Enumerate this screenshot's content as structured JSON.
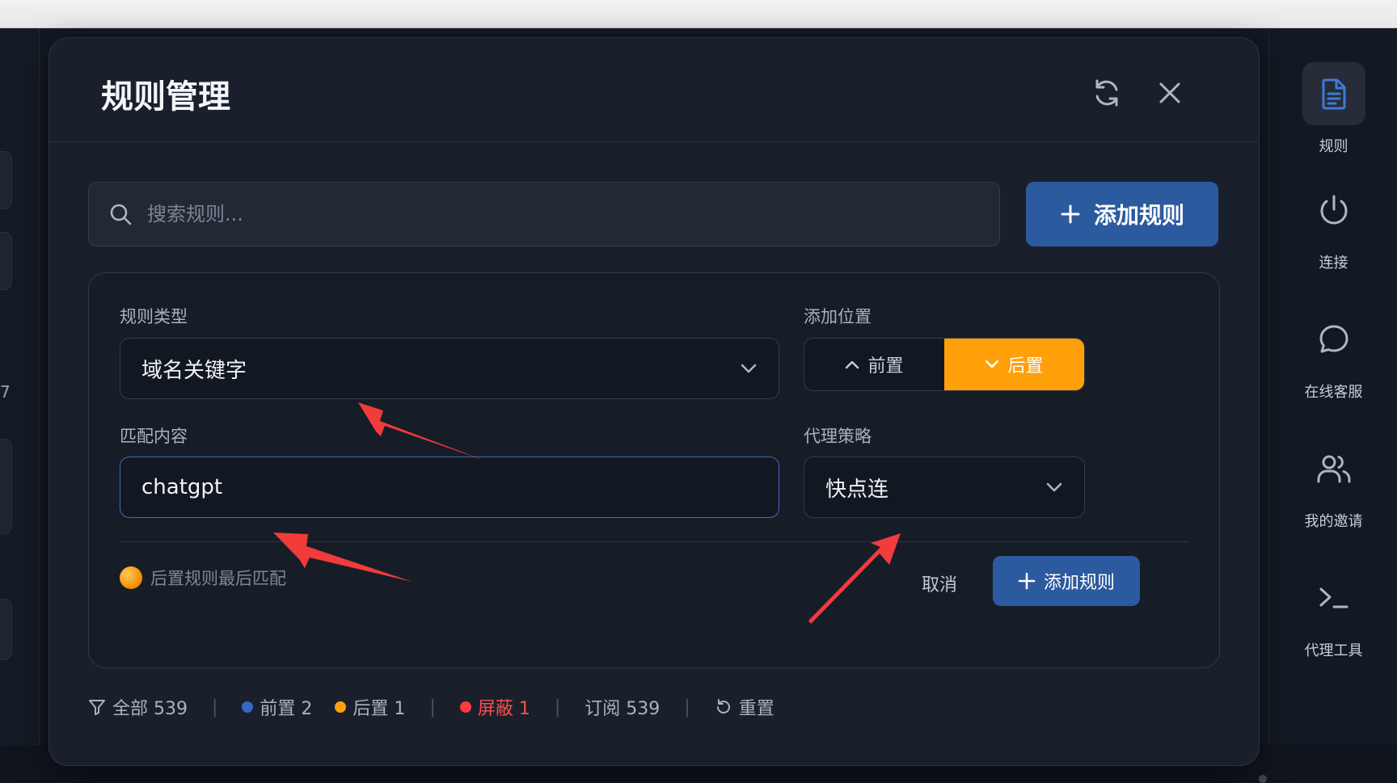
{
  "modal": {
    "title": "规则管理",
    "refresh_icon": "refresh-icon",
    "close_icon": "close-icon"
  },
  "search": {
    "placeholder": "搜索规则...",
    "add_button_label": "添加规则"
  },
  "form": {
    "rule_type_label": "规则类型",
    "rule_type_value": "域名关键字",
    "position_label": "添加位置",
    "position_options": [
      {
        "label": "前置",
        "icon": "chevron-up-icon",
        "selected": false
      },
      {
        "label": "后置",
        "icon": "chevron-down-icon",
        "selected": true
      }
    ],
    "match_label": "匹配内容",
    "match_value": "chatgpt",
    "policy_label": "代理策略",
    "policy_value": "快点连",
    "hint": "后置规则最后匹配",
    "cancel_label": "取消",
    "add_button_label": "添加规则"
  },
  "filter_bar": {
    "all": "全部 539",
    "front": "前置 2",
    "back": "后置 1",
    "blocked": "屏蔽 1",
    "subscribed": "订阅 539",
    "reset": "重置",
    "separator": "|"
  },
  "right_rail": {
    "items": [
      {
        "label": "规则",
        "icon": "document-icon",
        "active": true
      },
      {
        "label": "连接",
        "icon": "power-icon",
        "active": false
      },
      {
        "label": "在线客服",
        "icon": "chat-bubble-icon",
        "active": false
      },
      {
        "label": "我的邀请",
        "icon": "users-icon",
        "active": false
      },
      {
        "label": "代理工具",
        "icon": "terminal-icon",
        "active": false
      }
    ]
  },
  "left_panel": {
    "fragment_1": "7"
  },
  "colors": {
    "accent_blue": "#2b5a9e",
    "accent_orange": "#ff9f0a",
    "blocked_red": "#ff3b3b",
    "annotation_red": "#f23b3b"
  }
}
